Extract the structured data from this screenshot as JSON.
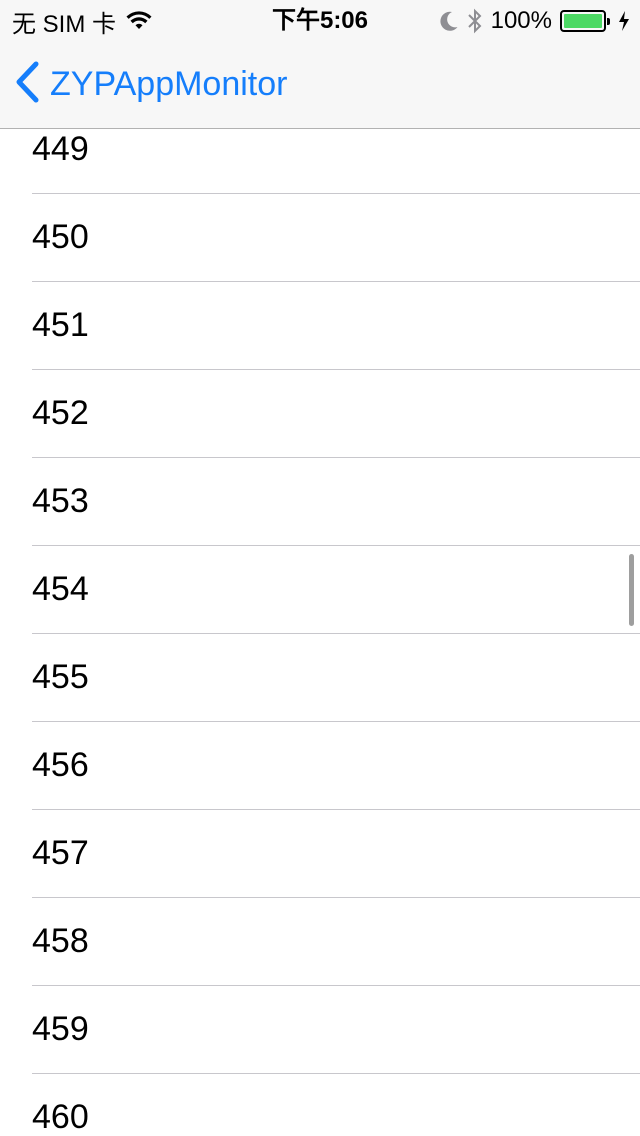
{
  "status_bar": {
    "carrier": "无 SIM 卡",
    "time": "下午5:06",
    "battery_percent": "100%",
    "battery_level": 1.0,
    "icons": [
      "wifi-icon",
      "moon-icon",
      "bluetooth-icon",
      "battery-icon",
      "charging-bolt-icon"
    ]
  },
  "nav": {
    "back_label": "ZYPAppMonitor",
    "back_icon": "chevron-left-icon",
    "tint_color": "#157efb"
  },
  "list": {
    "rows": [
      "449",
      "450",
      "451",
      "452",
      "453",
      "454",
      "455",
      "456",
      "457",
      "458",
      "459",
      "460"
    ]
  },
  "colors": {
    "bar_background": "#f7f7f7",
    "separator": "#c8c7cc",
    "battery_fill": "#4cd964"
  }
}
